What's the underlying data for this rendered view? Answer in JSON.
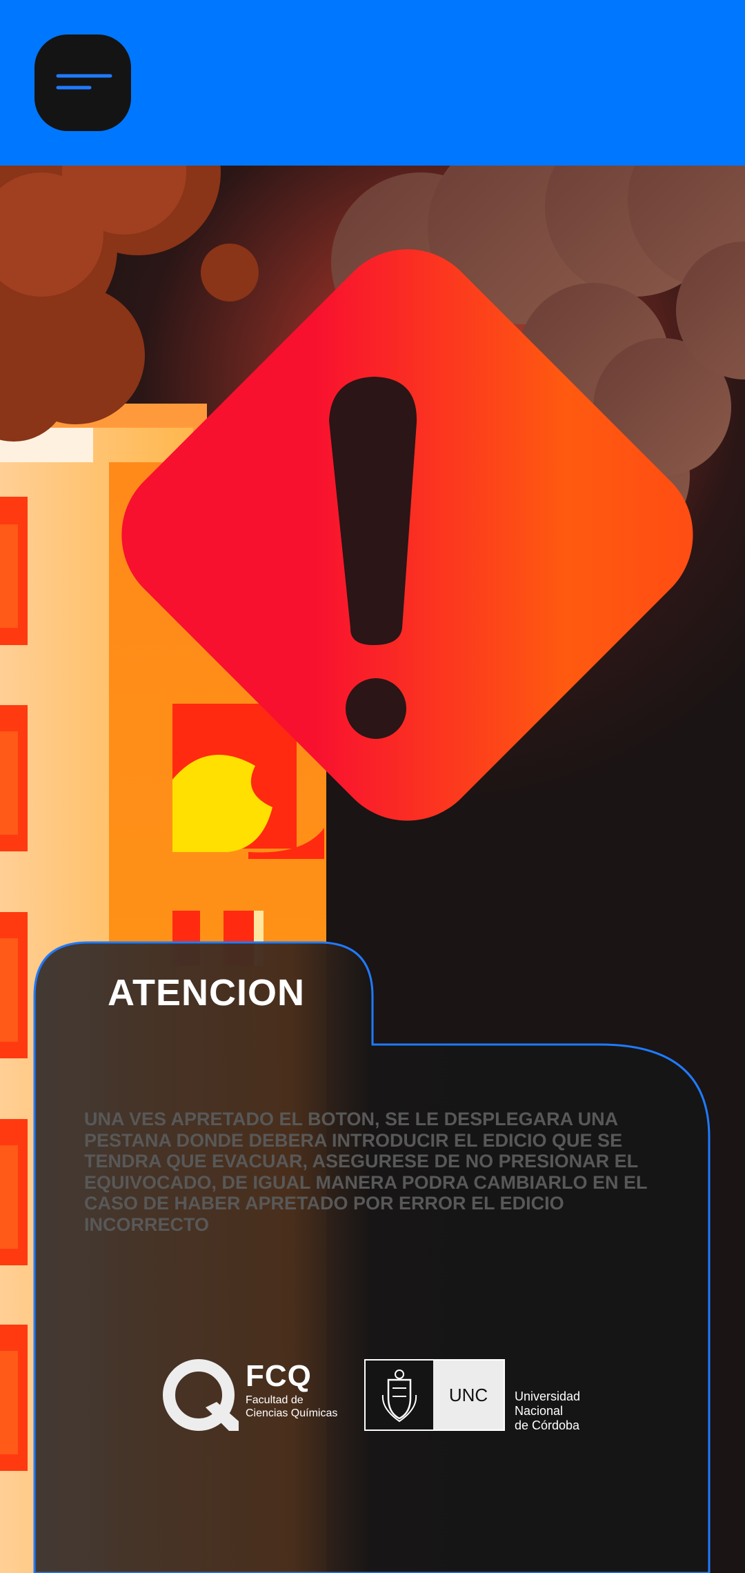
{
  "topbar": {
    "color": "#0077ff",
    "menu_icon": "hamburger-menu-icon"
  },
  "hero": {
    "icon": "warning-diamond-icon",
    "colors": {
      "warning": "#f8162f",
      "warning_mid": "#ff5a10"
    }
  },
  "card": {
    "title": "ATENCION",
    "message": "UNA VES APRETADO EL BOTON, SE LE DESPLEGARA UNA PESTANA DONDE DEBERA INTRODUCIR EL EDICIO QUE SE TENDRA QUE EVACUAR, ASEGURESE DE NO PRESIONAR EL EQUIVOCADO, DE IGUAL MANERA PODRA CAMBIARLO EN EL CASO DE HABER APRETADO POR ERROR EL EDICIO INCORRECTO",
    "border_color": "#1f7bff"
  },
  "logos": {
    "fcq": {
      "short": "FCQ",
      "line1": "Facultad de",
      "line2": "Ciencias Químicas"
    },
    "unc": {
      "short": "UNC",
      "line1": "Universidad",
      "line2": "Nacional",
      "line3": "de Córdoba"
    }
  }
}
